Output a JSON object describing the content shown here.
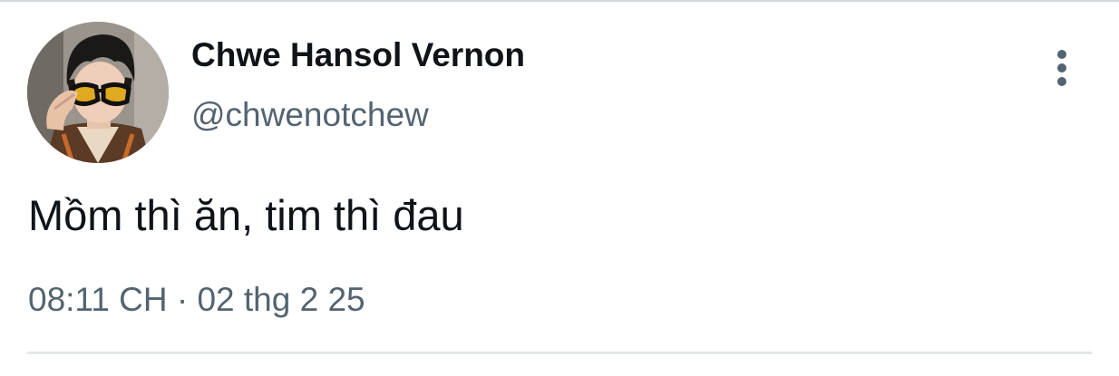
{
  "tweet": {
    "display_name": "Chwe Hansol Vernon",
    "handle": "@chwenotchew",
    "text": "Mồm thì ăn, tim thì đau",
    "time": "08:11 CH",
    "separator": "·",
    "date": "02 thg 2 25",
    "avatar_icon": "profile-photo",
    "more_icon": "more-vertical-icon"
  },
  "colors": {
    "text_primary": "#0f1419",
    "text_secondary": "#536471",
    "divider": "#e3e7ea"
  }
}
